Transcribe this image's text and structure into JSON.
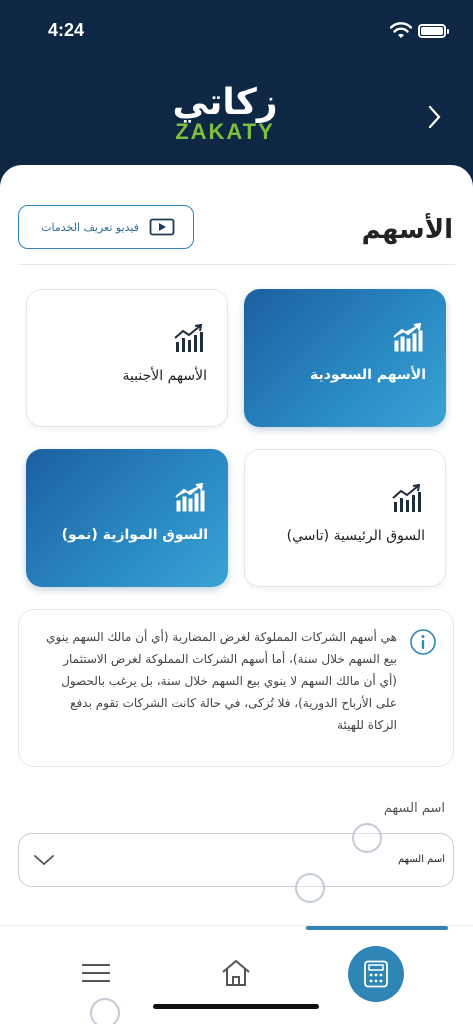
{
  "status_bar": {
    "time": "4:24"
  },
  "header": {
    "logo_ar": "زكاتي",
    "logo_en": "ZAKATY"
  },
  "page": {
    "title": "الأسهم",
    "video_button_label": "فيديو تعريف الخدمات"
  },
  "cards": [
    {
      "label": "الأسهم السعودية",
      "style": "blue"
    },
    {
      "label": "الأسهم الأجنبية",
      "style": "white"
    },
    {
      "label": "السوق الرئيسية (تاسي)",
      "style": "white"
    },
    {
      "label": "السوق الموازية (نمو)",
      "style": "blue"
    }
  ],
  "info": {
    "text": "هي أسهم الشركات المملوكة لغرض المضاربة (أي أن مالك السهم ينوي بيع السهم خلال سنة)، أما أسهم الشركات المملوكة لغرض الاستثمار (أي أن مالك السهم لا ينوي بيع السهم خلال سنة، بل يرغب بالحصول على الأرباح الدورية)، فلا تُزكى، في حالة كانت الشركات تقوم بدفع الزكاة للهيئة"
  },
  "stock_field": {
    "label": "اسم السهم",
    "value": "اسم السهم"
  },
  "colors": {
    "accent": "#2f86b6",
    "header_bg": "#0e2744",
    "logo_green": "#7bbf3c"
  }
}
